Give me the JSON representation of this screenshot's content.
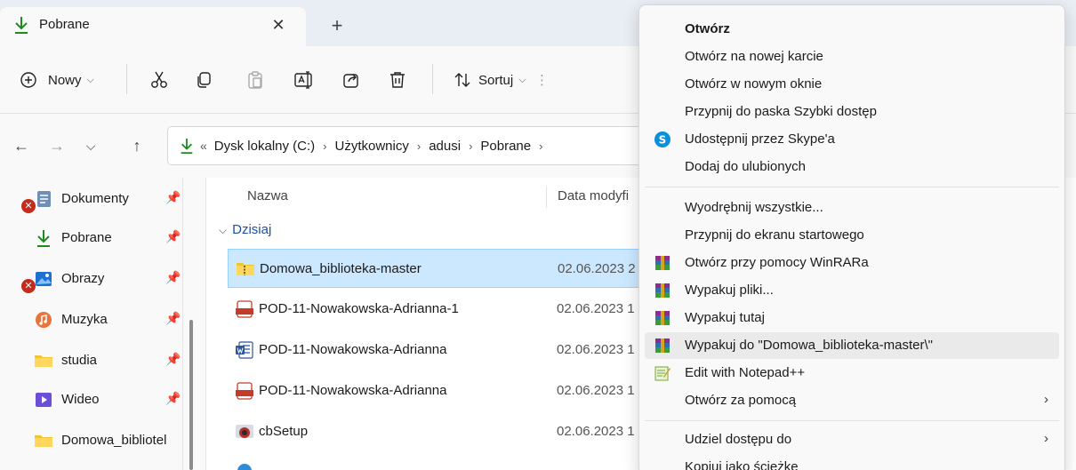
{
  "tab": {
    "title": "Pobrane",
    "icon": "download-arrow-icon",
    "close": "✕",
    "new_tab": "+"
  },
  "toolbar": {
    "new_label": "Nowy",
    "sort_label": "Sortuj",
    "icons": [
      "plus-circle-icon",
      "cut-icon",
      "copy-icon",
      "paste-icon",
      "rename-icon",
      "share-icon",
      "delete-icon",
      "sort-icon"
    ]
  },
  "address": {
    "overflow": "«",
    "crumbs": [
      "Dysk lokalny (C:)",
      "Użytkownicy",
      "adusi",
      "Pobrane"
    ]
  },
  "nav_pane": {
    "items": [
      {
        "label": "Dokumenty",
        "icon": "documents-icon",
        "error": true
      },
      {
        "label": "Pobrane",
        "icon": "download-arrow-icon",
        "error": false
      },
      {
        "label": "Obrazy",
        "icon": "pictures-icon",
        "error": true
      },
      {
        "label": "Muzyka",
        "icon": "music-icon",
        "error": false
      },
      {
        "label": "studia",
        "icon": "folder-icon",
        "error": false
      },
      {
        "label": "Wideo",
        "icon": "video-icon",
        "error": false
      },
      {
        "label": "Domowa_bibliotel",
        "icon": "folder-icon",
        "error": false
      }
    ]
  },
  "file_list": {
    "columns": {
      "name": "Nazwa",
      "date": "Data modyfi"
    },
    "group": "Dzisiaj",
    "rows": [
      {
        "name": "Domowa_biblioteka-master",
        "date": "02.06.2023 2",
        "icon": "zip-folder-icon",
        "selected": true
      },
      {
        "name": "POD-11-Nowakowska-Adrianna-1",
        "date": "02.06.2023 1",
        "icon": "pdf-icon",
        "selected": false
      },
      {
        "name": "POD-11-Nowakowska-Adrianna",
        "date": "02.06.2023 1",
        "icon": "word-icon",
        "selected": false
      },
      {
        "name": "POD-11-Nowakowska-Adrianna",
        "date": "02.06.2023 1",
        "icon": "pdf-icon",
        "selected": false
      },
      {
        "name": "cbSetup",
        "date": "02.06.2023 1",
        "icon": "installer-icon",
        "selected": false
      }
    ]
  },
  "context_menu": {
    "items": [
      {
        "label": "Otwórz",
        "bold": true
      },
      {
        "label": "Otwórz na nowej karcie"
      },
      {
        "label": "Otwórz w nowym oknie"
      },
      {
        "label": "Przypnij do paska Szybki dostęp"
      },
      {
        "label": "Udostępnij przez Skype'a",
        "icon": "skype-icon"
      },
      {
        "label": "Dodaj do ulubionych"
      },
      {
        "label": "Wyodrębnij wszystkie..."
      },
      {
        "label": "Przypnij do ekranu startowego"
      },
      {
        "label": "Otwórz przy pomocy WinRARa",
        "icon": "winrar-icon"
      },
      {
        "label": "Wypakuj pliki...",
        "icon": "winrar-icon"
      },
      {
        "label": "Wypakuj tutaj",
        "icon": "winrar-icon"
      },
      {
        "label": "Wypakuj do \"Domowa_biblioteka-master\\\"",
        "icon": "winrar-icon",
        "hover": true
      },
      {
        "label": "Edit with Notepad++",
        "icon": "notepadpp-icon"
      },
      {
        "label": "Otwórz za pomocą",
        "submenu": "›"
      },
      {
        "label": "Udziel dostępu do",
        "submenu": "›"
      },
      {
        "label": "Kopiuj jako ścieżkę"
      }
    ]
  },
  "colors": {
    "accent": "#1f8a1f",
    "selection": "#cce8ff",
    "error": "#c42b1c",
    "link": "#1f4f9e"
  }
}
